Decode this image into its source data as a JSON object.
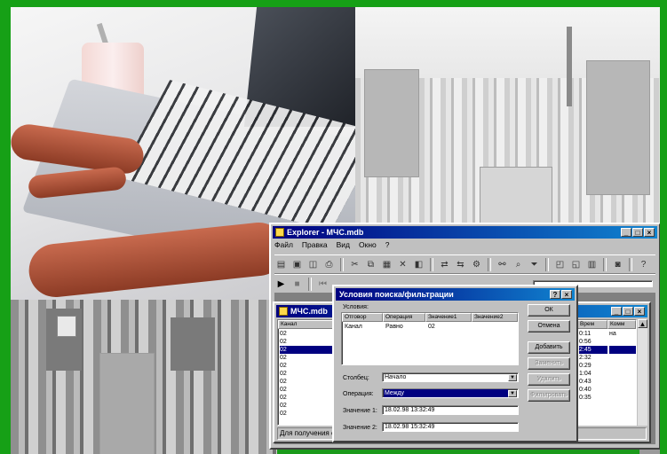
{
  "explorer": {
    "title": "Explorer - МЧС.mdb",
    "menu": [
      "Файл",
      "Правка",
      "Вид",
      "Окно",
      "?"
    ]
  },
  "mdi_child": {
    "title": "МЧС.mdb",
    "left_columns": [
      "Канал"
    ],
    "left_rows": [
      "02",
      "02",
      "02",
      "02",
      "02",
      "02",
      "02",
      "02",
      "02",
      "02",
      "02"
    ],
    "right_columns": [
      "Врем",
      "Комм"
    ],
    "right_rows": [
      [
        "0:11",
        "на"
      ],
      [
        "0:56",
        ""
      ],
      [
        "2:45",
        ""
      ],
      [
        "2:32",
        ""
      ],
      [
        "0:29",
        ""
      ],
      [
        "1:04",
        ""
      ],
      [
        "0:43",
        ""
      ],
      [
        "0:40",
        ""
      ],
      [
        "0:35",
        ""
      ]
    ],
    "status": "Для получения с"
  },
  "dialog": {
    "title": "Условия поиска/фильтрации",
    "conditions_label": "Условия:",
    "columns": [
      "Отговор",
      "Операция",
      "Значение1",
      "Значение2"
    ],
    "rows": [
      [
        "Канал",
        "Равно",
        "02",
        ""
      ]
    ],
    "field_label": "Столбец:",
    "field_value": "Начало",
    "operation_label": "Операция:",
    "operation_value": "Между",
    "value1_label": "Значение 1:",
    "value1": "18.02.98 13:32:49",
    "value2_label": "Значение 2:",
    "value2": "18.02.98 15:32:49",
    "buttons": {
      "ok": "ОК",
      "cancel": "Отмена",
      "add": "Добавить",
      "change": "Заменить",
      "delete": "Удалить",
      "filter": "Фильтровать"
    }
  }
}
